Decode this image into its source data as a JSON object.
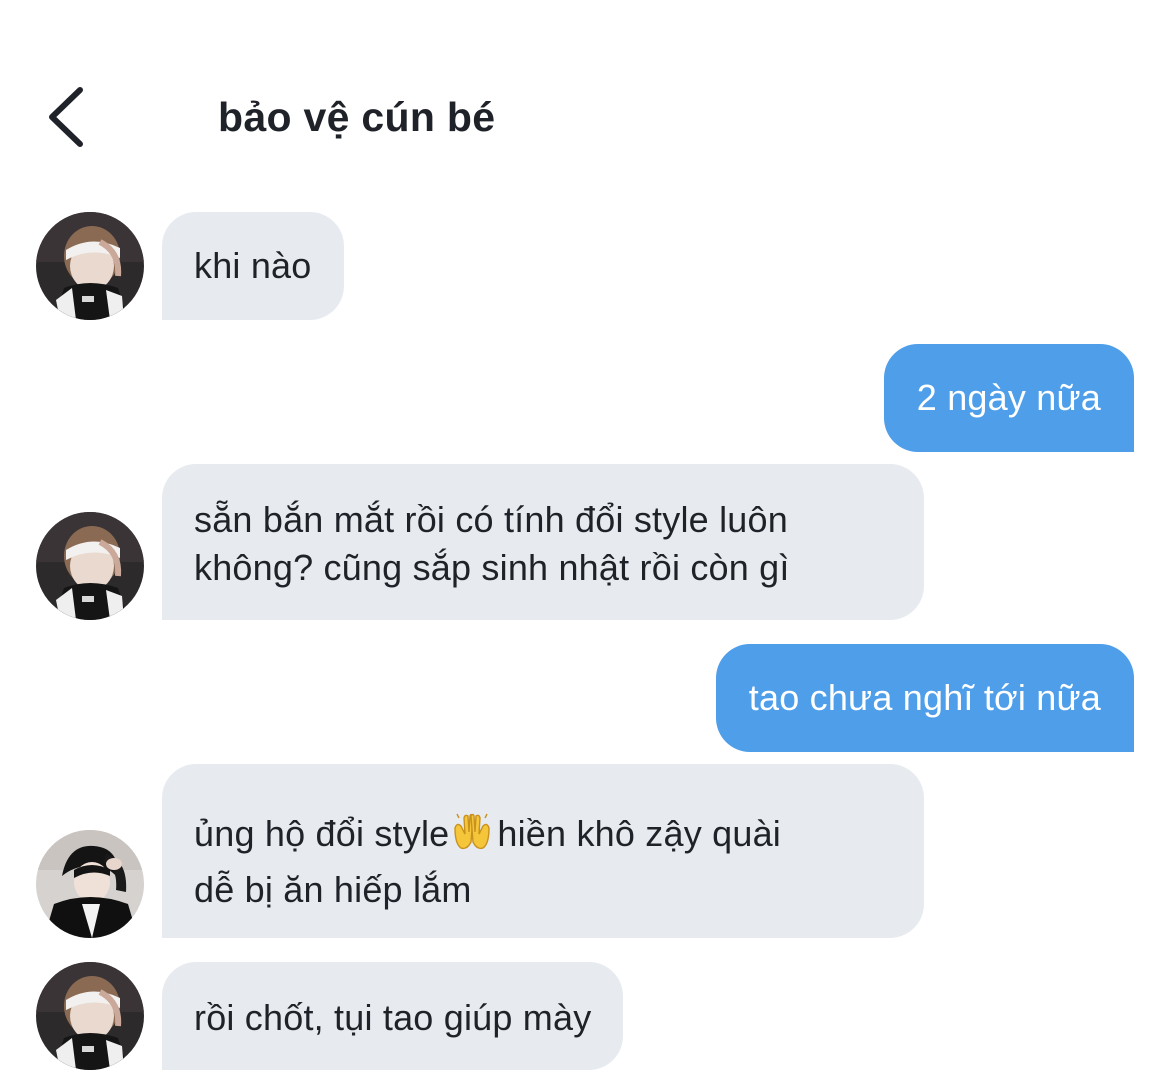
{
  "header": {
    "back_icon": "chevron-left-icon",
    "title": "bảo vệ cún bé"
  },
  "messages": [
    {
      "direction": "incoming",
      "avatar": "avatar-headband-photo",
      "lines": [
        "khi nào"
      ]
    },
    {
      "direction": "outgoing",
      "lines": [
        "2 ngày nữa"
      ]
    },
    {
      "direction": "incoming",
      "avatar": "avatar-headband-photo",
      "lines": [
        "sẵn bắn mắt rồi có tính đổi style luôn",
        "không? cũng sắp sinh nhật rồi còn gì"
      ]
    },
    {
      "direction": "outgoing",
      "lines": [
        "tao chưa nghĩ tới nữa"
      ]
    },
    {
      "direction": "incoming",
      "avatar": "avatar-leather-jacket-photo",
      "segments": [
        "ủng hộ đổi style",
        "raising-hands-emoji",
        "hiền khô zậy quài"
      ],
      "lines": [
        "dễ bị ăn hiếp lắm"
      ]
    },
    {
      "direction": "incoming",
      "avatar": "avatar-headband-photo",
      "lines": [
        "rồi chốt, tụi tao giúp mày"
      ]
    }
  ],
  "colors": {
    "incoming_bubble": "#e7ebf0",
    "outgoing_bubble": "#4e9eea",
    "text": "#1f2329"
  }
}
